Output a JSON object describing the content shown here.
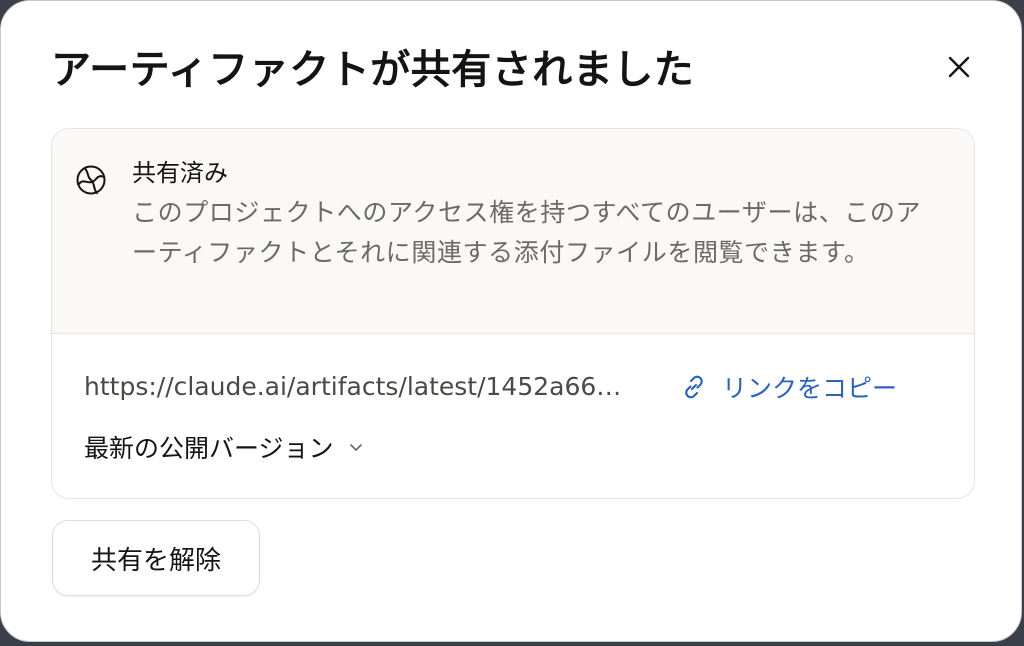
{
  "dialog": {
    "title": "アーティファクトが共有されました",
    "close_icon": "close-icon"
  },
  "share_status": {
    "icon": "globe-icon",
    "title": "共有済み",
    "description": "このプロジェクトへのアクセス権を持つすべてのユーザーは、このアーティファクトとそれに関連する添付ファイルを閲覧できます。"
  },
  "link": {
    "url": "https://claude.ai/artifacts/latest/1452a66…",
    "copy_icon": "link-icon",
    "copy_label": "リンクをコピー"
  },
  "version_select": {
    "selected": "最新の公開バージョン",
    "icon": "chevron-down-icon"
  },
  "unshare_button": {
    "label": "共有を解除"
  },
  "colors": {
    "accent": "#2c64b8",
    "text": "#141413",
    "muted": "#6b6a66",
    "card_top_bg": "#faf9f7"
  }
}
